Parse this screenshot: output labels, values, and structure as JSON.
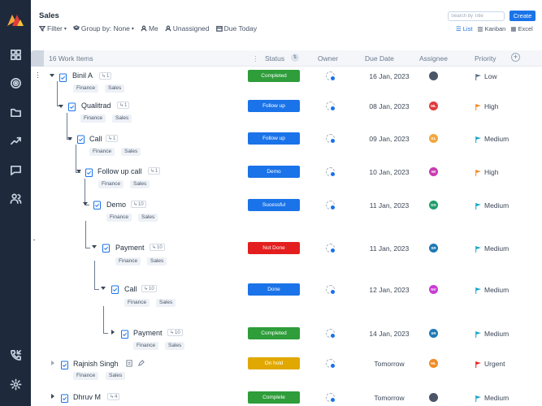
{
  "header": {
    "title": "Sales",
    "filter_label": "Filter",
    "group_by_label": "Group by: None",
    "me_label": "Me",
    "unassigned_label": "Unassigned",
    "due_today_label": "Due Today",
    "search_placeholder": "Search by Title",
    "create_label": "Create",
    "views": {
      "list": "List",
      "kanban": "Kanban",
      "excel": "Excel"
    }
  },
  "columns": {
    "count_label": "16 Work Items",
    "status": "Status",
    "owner": "Owner",
    "due_date": "Due Date",
    "assignee": "Assignee",
    "priority": "Priority"
  },
  "rows": [
    {
      "name": "Binil A",
      "count": "1",
      "tags": [
        "Finance",
        "Sales"
      ],
      "status": "Completed",
      "status_color": "#2e9d3a",
      "due": "16 Jan, 2023",
      "assignee": "",
      "assignee_color": "#4a5568",
      "priority": "Low",
      "flag_color": "#5a6b85"
    },
    {
      "name": "Qualitrad",
      "count": "1",
      "tags": [
        "Finance",
        "Sales"
      ],
      "status": "Follow up",
      "status_color": "#1a73e8",
      "due": "08 Jan, 2023",
      "assignee": "ML",
      "assignee_color": "#e03b3b",
      "priority": "High",
      "flag_color": "#f08a24"
    },
    {
      "name": "Call",
      "count": "1",
      "tags": [
        "Finance",
        "Sales"
      ],
      "status": "Follow up",
      "status_color": "#1a73e8",
      "due": "09 Jan, 2023",
      "assignee": "KL",
      "assignee_color": "#f2a73b",
      "priority": "Medium",
      "flag_color": "#13a5c9"
    },
    {
      "name": "Follow up call",
      "count": "1",
      "tags": [
        "Finance",
        "Sales"
      ],
      "status": "Demo",
      "status_color": "#1a73e8",
      "due": "10 Jan, 2023",
      "assignee": "WI",
      "assignee_color": "#c93bb0",
      "priority": "High",
      "flag_color": "#f08a24"
    },
    {
      "name": "Demo",
      "count": "10",
      "tags": [
        "Finance",
        "Sales"
      ],
      "status": "Sucessful",
      "status_color": "#1a73e8",
      "due": "11 Jan, 2023",
      "assignee": "DS",
      "assignee_color": "#1f9d6b",
      "priority": "Medium",
      "flag_color": "#13a5c9"
    },
    {
      "name": "Payment",
      "count": "10",
      "tags": [
        "Finance",
        "Sales"
      ],
      "status": "Not Done",
      "status_color": "#e41e1e",
      "due": "11 Jan, 2023",
      "assignee": "SR",
      "assignee_color": "#1e78b5",
      "priority": "Medium",
      "flag_color": "#13a5c9"
    },
    {
      "name": "Call",
      "count": "10",
      "tags": [
        "Finance",
        "Sales"
      ],
      "status": "Done",
      "status_color": "#1a73e8",
      "due": "12 Jan, 2023",
      "assignee": "NV",
      "assignee_color": "#c93bd6",
      "priority": "Medium",
      "flag_color": "#13a5c9"
    },
    {
      "name": "Payment",
      "count": "10",
      "tags": [
        "Finance",
        "Sales"
      ],
      "status": "Completed",
      "status_color": "#2e9d3a",
      "due": "14 Jan, 2023",
      "assignee": "SR",
      "assignee_color": "#1e78b5",
      "priority": "Medium",
      "flag_color": "#13a5c9"
    },
    {
      "name": "Rajnish Singh",
      "count": "",
      "tags": [
        "Finance",
        "Sales"
      ],
      "status": "On hold",
      "status_color": "#e0a800",
      "due": "Tomorrow",
      "assignee": "ML",
      "assignee_color": "#f08a24",
      "priority": "Urgent",
      "flag_color": "#e41e1e"
    },
    {
      "name": "Dhruv M",
      "count": "4",
      "tags": [],
      "status": "Complete",
      "status_color": "#2e9d3a",
      "due": "Tomorrow",
      "assignee": "",
      "assignee_color": "#4a5568",
      "priority": "Medium",
      "flag_color": "#13a5c9"
    }
  ]
}
